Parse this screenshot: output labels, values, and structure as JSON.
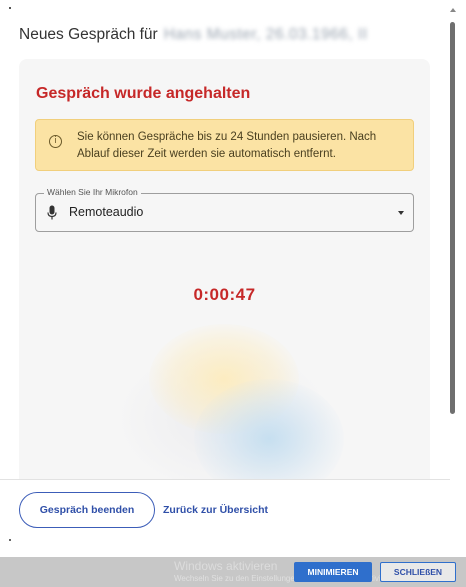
{
  "dialog": {
    "title_prefix": "Neues Gespräch für",
    "title_redacted": "Hans Muster, 26.03.1966, II"
  },
  "card": {
    "heading": "Gespräch wurde angehalten",
    "info_text": "Sie können Gespräche bis zu 24 Stunden pausieren. Nach Ablauf dieser Zeit werden sie automatisch entfernt.",
    "mic_label": "Wählen Sie Ihr Mikrofon",
    "mic_value": "Remoteaudio",
    "timer": "0:00:47"
  },
  "footer": {
    "end_button": "Gespräch beenden",
    "back_link": "Zurück zur Übersicht"
  },
  "taskbar": {
    "activate_title": "Windows aktivieren",
    "activate_sub": "Wechseln Sie zu den Einstellungen, um Windows zu aktivieren.",
    "minimize_button": "MINIMIEREN",
    "close_button": "SCHLIEßEN"
  },
  "colors": {
    "accent_red": "#c62828",
    "primary_blue": "#2f4fa8",
    "info_bg": "#fbe3a4",
    "taskbar_bg": "#c7c7c7"
  },
  "icons": {
    "info": "info-icon",
    "mic": "microphone-icon",
    "dropdown": "chevron-down-icon"
  }
}
